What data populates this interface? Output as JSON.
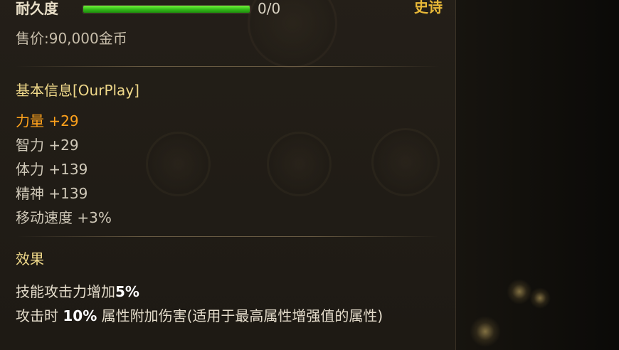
{
  "item": {
    "durability_label": "耐久度",
    "durability_value": "0/0",
    "durability_fraction": 1.0,
    "rarity": "史诗",
    "price": "售价:90,000金币"
  },
  "basic_info": {
    "title": "基本信息[OurPlay]",
    "stats": [
      {
        "text": "力量 +29",
        "highlight": true
      },
      {
        "text": "智力 +29",
        "highlight": false
      },
      {
        "text": "体力 +139",
        "highlight": false
      },
      {
        "text": "精神 +139",
        "highlight": false
      },
      {
        "text": "移动速度 +3%",
        "highlight": false
      }
    ]
  },
  "effects": {
    "title": "效果",
    "line1_prefix": "技能攻击力增加",
    "line1_value": "5%",
    "line2_prefix": "攻击时 ",
    "line2_value": "10%",
    "line2_suffix": " 属性附加伤害(适用于最高属性增强值的属性)"
  },
  "colors": {
    "rarity": "#e8b838",
    "highlight_stat": "#ffa21c",
    "section_title": "#f0d98a",
    "durability_bar": "#3fd11f"
  }
}
